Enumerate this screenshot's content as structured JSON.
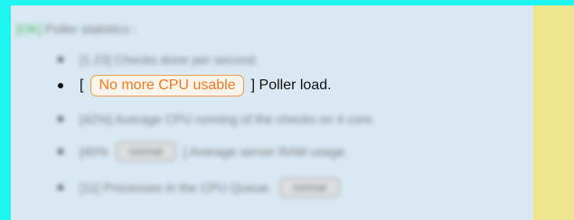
{
  "panel": {
    "heading": {
      "tag": "[OK]",
      "text": "Poller statistics :"
    },
    "items": [
      {
        "text": "[1.23] Checks done per second."
      },
      {
        "prefix": "[",
        "badge": "No more CPU usable",
        "suffix": "] Poller load."
      },
      {
        "text": "[42%] Average CPU running of the checks on 4 core."
      },
      {
        "prefix": "[40%",
        "badge": "normal",
        "suffix": "] Average server RAM usage."
      },
      {
        "prefix": "[11] Processes in the CPU Queue.",
        "badge": "normal"
      }
    ]
  },
  "colors": {
    "background": "#1ef4f0",
    "panel": "#d9e8f3",
    "side_panel": "#efe58f",
    "warning_badge": "#f07b21",
    "ok_tag": "#33b84a"
  }
}
